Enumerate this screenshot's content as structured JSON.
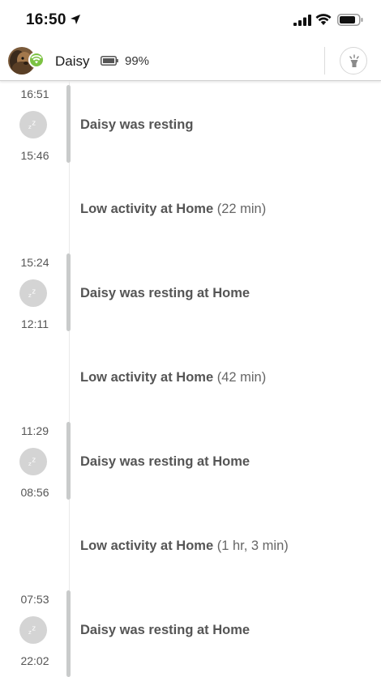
{
  "status_bar": {
    "time": "16:50"
  },
  "header": {
    "pet_name": "Daisy",
    "battery_percent": "99%",
    "status_color": "#7cc242"
  },
  "timeline": {
    "rest_events": [
      {
        "start_time": "16:51",
        "end_time": "15:46",
        "text": "Daisy was resting"
      },
      {
        "start_time": "15:24",
        "end_time": "12:11",
        "text": "Daisy was resting at Home"
      },
      {
        "start_time": "11:29",
        "end_time": "08:56",
        "text": "Daisy was resting at Home"
      },
      {
        "start_time": "07:53",
        "end_time": "22:02",
        "text": "Daisy was resting at Home"
      }
    ],
    "activity_events": [
      {
        "text": "Low activity at Home",
        "duration": "(22 min)"
      },
      {
        "text": "Low activity at Home",
        "duration": "(42 min)"
      },
      {
        "text": "Low activity at Home",
        "duration": "(1 hr, 3 min)"
      }
    ]
  }
}
